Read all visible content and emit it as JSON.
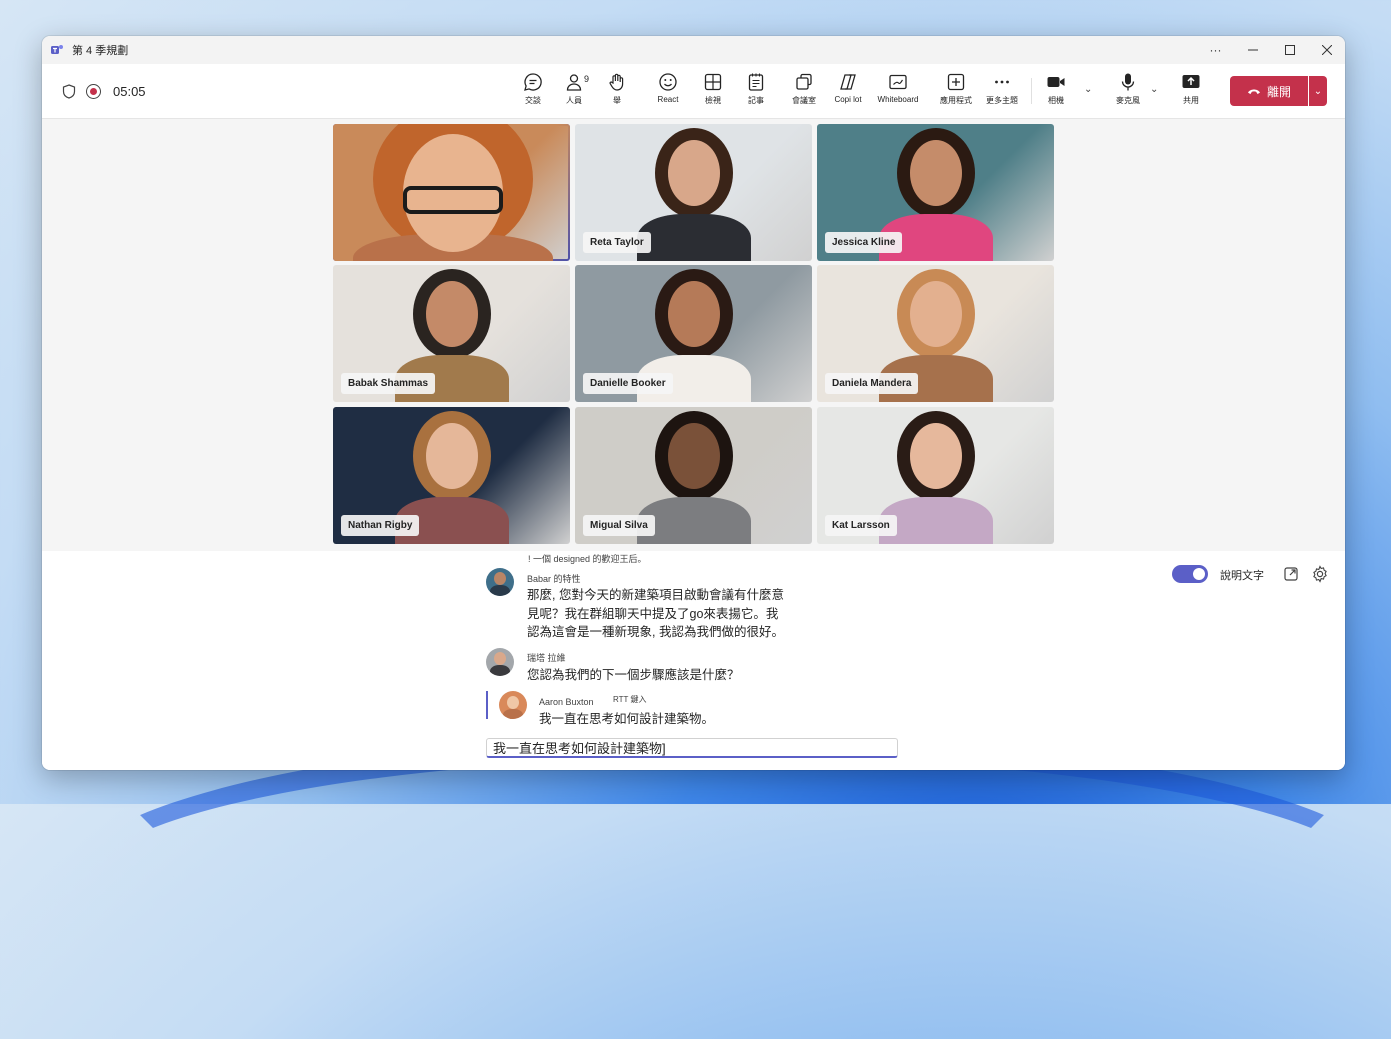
{
  "window": {
    "title": "第 4 季規劃"
  },
  "toolbar": {
    "timer": "05:05",
    "buttons": {
      "chat": "交談",
      "people": "人員",
      "people_count": "9",
      "raise": "舉",
      "react": "React",
      "view": "檢視",
      "notes": "記事",
      "rooms": "會議室",
      "copilot": "Copi lot",
      "whiteboard": "Whiteboard",
      "apps": "應用程式",
      "more": "更多主題",
      "camera": "相機",
      "mic": "麥克風",
      "share": "共用"
    },
    "leave": "離開"
  },
  "participants": [
    {
      "name": "",
      "bg": "#c98a5a",
      "skin": "#e8b48f",
      "hair": "#c0652c",
      "shirt": "#b9714a"
    },
    {
      "name": "Reta Taylor",
      "bg": "#dfe3e6",
      "skin": "#d8a78a",
      "hair": "#3a2418",
      "shirt": "#2b2d33"
    },
    {
      "name": "Jessica Kline",
      "bg": "#4f7f88",
      "skin": "#c58c6a",
      "hair": "#2b1a12",
      "shirt": "#e0467f"
    },
    {
      "name": "Babak Shammas",
      "bg": "#e5e1dc",
      "skin": "#c48a68",
      "hair": "#2a2420",
      "shirt": "#a17a4c"
    },
    {
      "name": "Danielle Booker",
      "bg": "#8f9aa1",
      "skin": "#b57a58",
      "hair": "#2a1a14",
      "shirt": "#f2eee9"
    },
    {
      "name": "Daniela Mandera",
      "bg": "#e9e4dd",
      "skin": "#e3b08f",
      "hair": "#c88a55",
      "shirt": "#a6714c"
    },
    {
      "name": "Nathan Rigby",
      "bg": "#1f2d43",
      "skin": "#e5b799",
      "hair": "#a9713f",
      "shirt": "#8a5050"
    },
    {
      "name": "Migual Silva",
      "bg": "#cfcdc8",
      "skin": "#7a5139",
      "hair": "#1d1410",
      "shirt": "#7c7d80"
    },
    {
      "name": "Kat Larsson",
      "bg": "#e6e7e5",
      "skin": "#e6b89c",
      "hair": "#2a1c16",
      "shirt": "#c4a8c5"
    }
  ],
  "captions": {
    "cut_line": "! 一個 designed 的歡迎王后。",
    "toggle_label": "說明文字",
    "entries": [
      {
        "sender": "Babar 的特性",
        "lines": [
          "那麼, 您對今天的新建築項目啟動會議有什麼意",
          "見呢？我在群組聊天中提及了go來表揚它。我",
          "認為這會是一種新現象, 我認為我們做的很好。"
        ]
      },
      {
        "sender": "瑞塔 拉維",
        "lines": [
          "您認為我們的下一個步驟應該是什麼？"
        ]
      },
      {
        "sender": "Aaron Buxton",
        "tag": "RTT 鍵入",
        "lines": [
          "我一直在思考如何設計建築物。"
        ]
      }
    ],
    "input_value": "我一直在思考如何設計建築物]"
  }
}
